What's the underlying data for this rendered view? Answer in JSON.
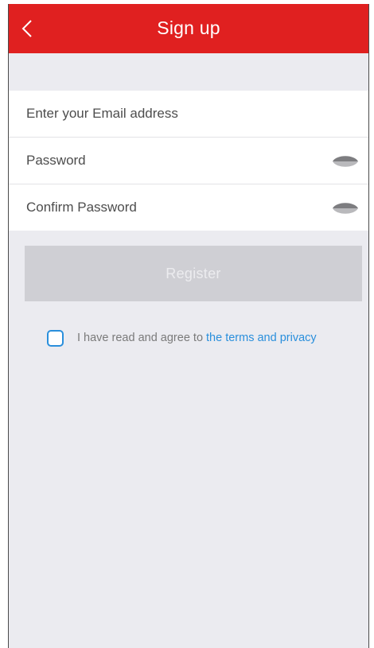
{
  "header": {
    "title": "Sign up",
    "back_icon": "chevron-left-icon",
    "color": "#e02020"
  },
  "form": {
    "email_placeholder": "Enter your Email address",
    "password_placeholder": "Password",
    "confirm_password_placeholder": "Confirm Password",
    "visibility_icon": "eye-toggle-icon"
  },
  "register": {
    "label": "Register",
    "state": "disabled"
  },
  "agreement": {
    "checked": false,
    "text": "I have read and agree to",
    "link_text": "the terms and privacy",
    "link_color": "#2a8fdc"
  }
}
